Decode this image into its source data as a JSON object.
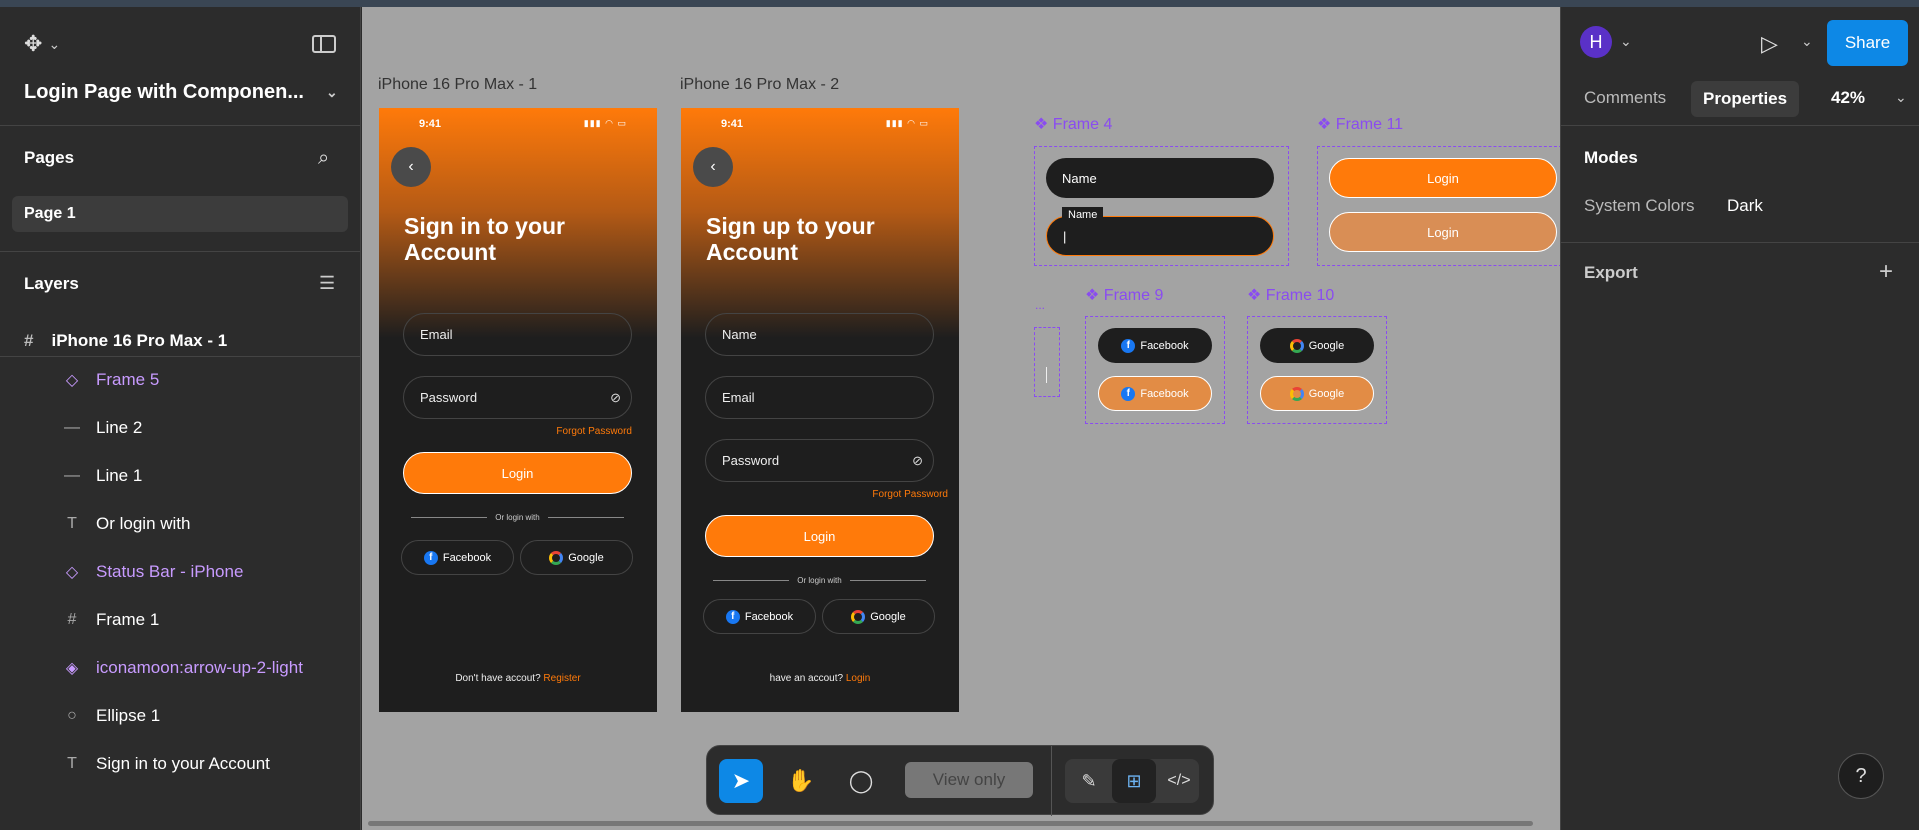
{
  "app": {
    "file_title": "Login Page with Componen...",
    "pages_label": "Pages",
    "page_selected": "Page 1",
    "layers_label": "Layers",
    "layer_root": "iPhone 16 Pro Max - 1",
    "layers": [
      {
        "label": "Frame 5",
        "icon": "component-icon"
      },
      {
        "label": "Line 2",
        "icon": "line-icon"
      },
      {
        "label": "Line 1",
        "icon": "line-icon"
      },
      {
        "label": "Or login with",
        "icon": "text-icon"
      },
      {
        "label": "Status Bar - iPhone",
        "icon": "component-icon"
      },
      {
        "label": "Frame 1",
        "icon": "frame-icon"
      },
      {
        "label": "iconamoon:arrow-up-2-light",
        "icon": "instance-icon"
      },
      {
        "label": "Ellipse 1",
        "icon": "ellipse-icon"
      },
      {
        "label": "Sign in to your Account",
        "icon": "text-icon"
      }
    ]
  },
  "canvas": {
    "frame1_label": "iPhone 16 Pro Max - 1",
    "frame2_label": "iPhone 16 Pro Max - 2",
    "phone1": {
      "time": "9:41",
      "title": "Sign in to your Account",
      "email": "Email",
      "password": "Password",
      "forgot": "Forgot Password",
      "login": "Login",
      "or": "Or login with",
      "facebook": "Facebook",
      "google": "Google",
      "footer_text": "Don't have accout?",
      "footer_link": "Register"
    },
    "phone2": {
      "time": "9:41",
      "title": "Sign up to your Account",
      "name": "Name",
      "email": "Email",
      "password": "Password",
      "forgot": "Forgot Password",
      "login": "Login",
      "or": "Or login with",
      "facebook": "Facebook",
      "google": "Google",
      "footer_text": "have an accout?",
      "footer_link": "Login"
    },
    "frame4": {
      "label": "Frame 4",
      "field1": "Name",
      "float_label": "Name"
    },
    "frame11": {
      "label": "Frame 11",
      "btn1": "Login",
      "btn2": "Login"
    },
    "frame9": {
      "label": "Frame 9",
      "btn1": "Facebook",
      "btn2": "Facebook"
    },
    "frame10": {
      "label": "Frame 10",
      "btn1": "Google",
      "btn2": "Google"
    },
    "ellipsis": "..."
  },
  "toolbar": {
    "view_only": "View only"
  },
  "right": {
    "avatar": "H",
    "share": "Share",
    "tab_comments": "Comments",
    "tab_properties": "Properties",
    "zoom": "42%",
    "modes": "Modes",
    "system_colors": "System Colors",
    "dark": "Dark",
    "export": "Export",
    "help": "?"
  },
  "colors": {
    "accent": "#ff7a0a",
    "component": "#8a4cf0",
    "share": "#0d88e6"
  }
}
